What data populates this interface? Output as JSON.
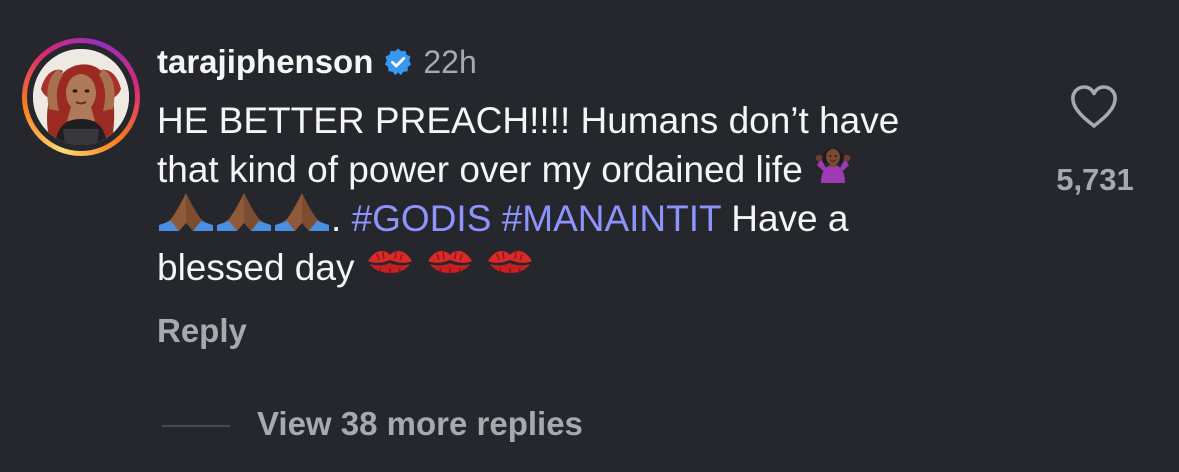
{
  "comment": {
    "username": "tarajiphenson",
    "verified": true,
    "timestamp": "22h",
    "text_lines": [
      "HE BETTER PREACH!!!! Humans don’t have",
      "that kind of power over my ordained life",
      ". ",
      "#GODIS",
      "#MANAINTIT",
      " Have a",
      "blessed day"
    ],
    "emojis": {
      "line2": "person-shrugging-emoji",
      "line3": [
        "folded-hands-emoji",
        "folded-hands-emoji",
        "folded-hands-emoji"
      ],
      "line4": [
        "kiss-mark-emoji",
        "kiss-mark-emoji",
        "kiss-mark-emoji"
      ]
    },
    "like_count": "5,731",
    "reply_label": "Reply",
    "view_replies_label": "View 38 more replies"
  },
  "colors": {
    "background": "#25272c",
    "text": "#f5f5f5",
    "muted": "#a8a9ad",
    "hashtag": "#8d93ff",
    "verified": "#3897f0"
  }
}
